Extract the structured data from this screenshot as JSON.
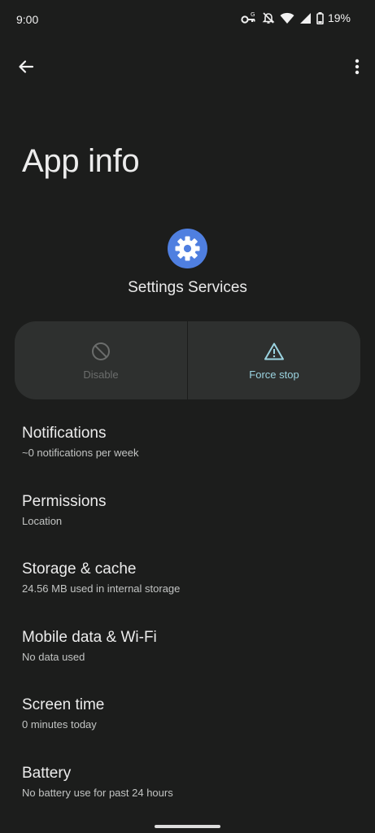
{
  "status_bar": {
    "time": "9:00",
    "battery_percent": "19%",
    "icons": [
      "vpn-key-icon",
      "mute-icon",
      "wifi-icon",
      "signal-icon",
      "battery-icon"
    ]
  },
  "toolbar": {
    "back_icon": "arrow-back-icon",
    "more_icon": "more-vert-icon"
  },
  "page": {
    "title": "App info"
  },
  "app": {
    "name": "Settings Services",
    "icon": "gear-icon",
    "icon_color": "#4f7fe0"
  },
  "actions": {
    "disable_label": "Disable",
    "force_stop_label": "Force stop",
    "accent_color": "#9bd3e0"
  },
  "settings": [
    {
      "title": "Notifications",
      "subtitle": "~0 notifications per week"
    },
    {
      "title": "Permissions",
      "subtitle": "Location"
    },
    {
      "title": "Storage & cache",
      "subtitle": "24.56 MB used in internal storage"
    },
    {
      "title": "Mobile data & Wi-Fi",
      "subtitle": "No data used"
    },
    {
      "title": "Screen time",
      "subtitle": "0 minutes today"
    },
    {
      "title": "Battery",
      "subtitle": "No battery use for past 24 hours"
    }
  ]
}
